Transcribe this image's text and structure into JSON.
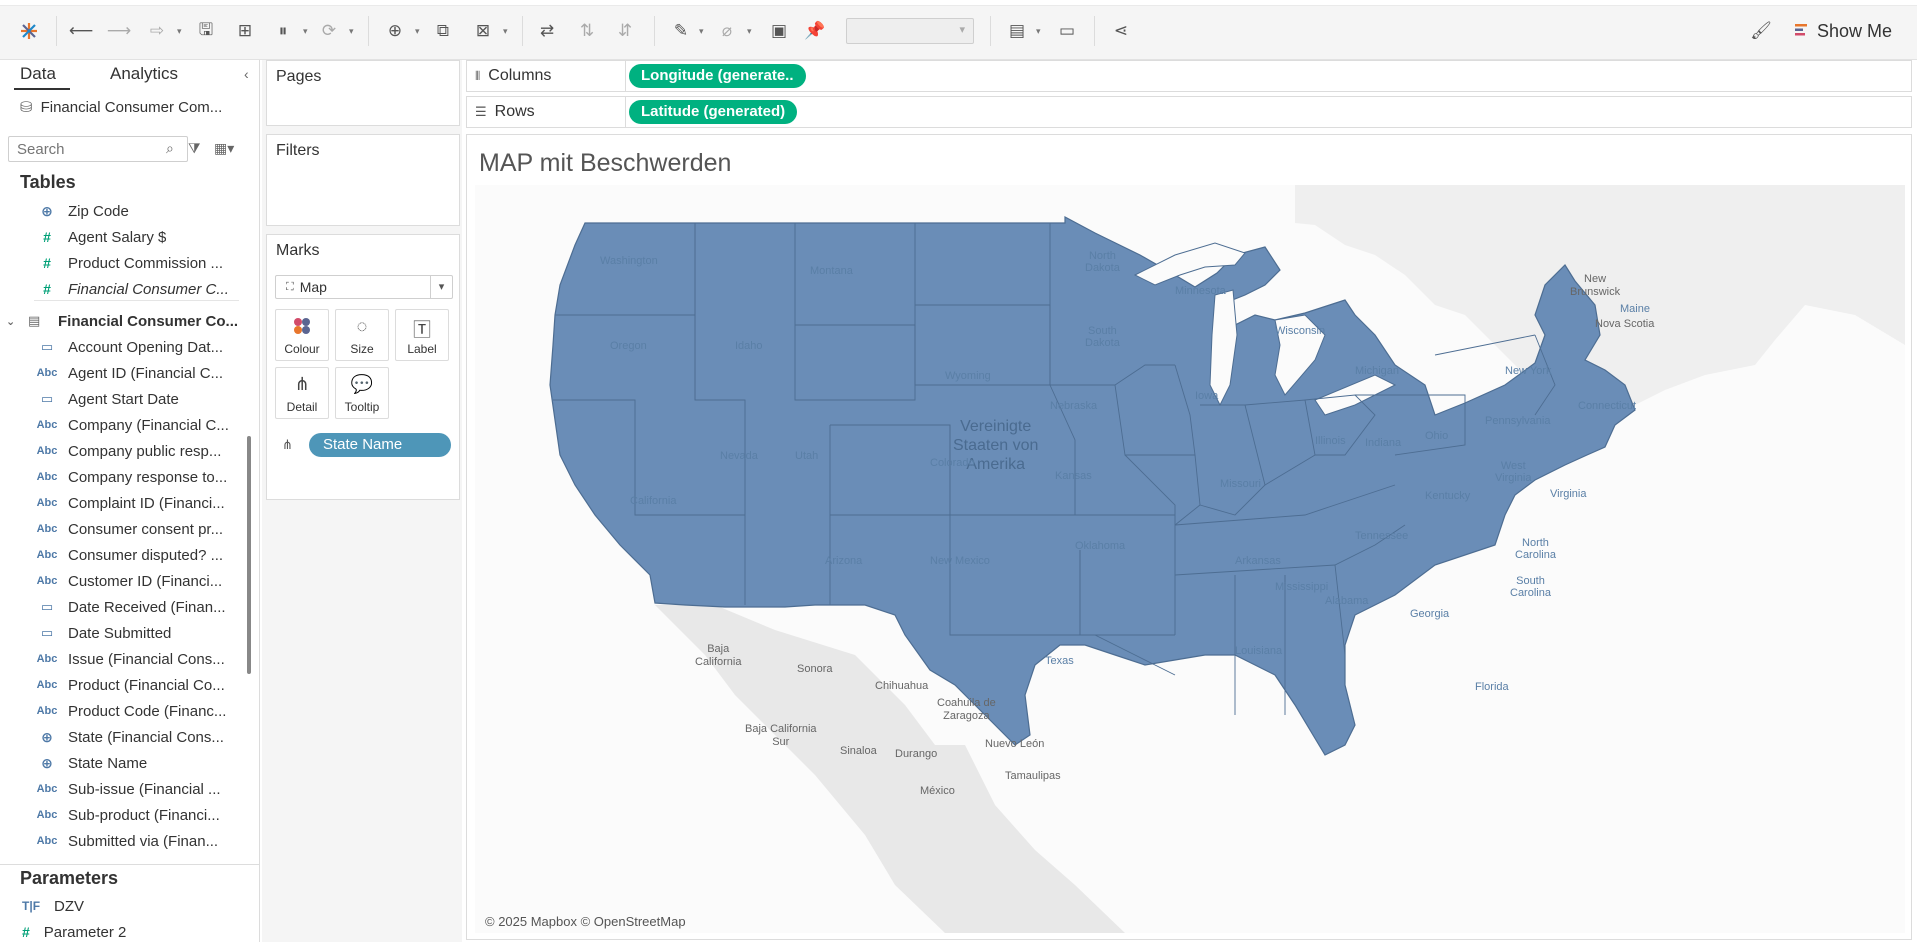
{
  "toolbar": {
    "show_me_label": "Show Me"
  },
  "left_panel": {
    "tab_data": "Data",
    "tab_analytics": "Analytics",
    "datasource": "Financial Consumer Com...",
    "search_placeholder": "Search",
    "tables_heading": "Tables",
    "top_fields": [
      {
        "type": "geo",
        "name": "Zip Code"
      },
      {
        "type": "measure",
        "name": "Agent Salary $"
      },
      {
        "type": "measure",
        "name": "Product Commission ..."
      },
      {
        "type": "measure",
        "name": "Financial Consumer C...",
        "italic": true
      }
    ],
    "table_name": "Financial Consumer Co...",
    "fields": [
      {
        "type": "date",
        "name": "Account Opening Dat..."
      },
      {
        "type": "abc",
        "name": "Agent ID (Financial C..."
      },
      {
        "type": "date",
        "name": "Agent Start Date"
      },
      {
        "type": "abc",
        "name": "Company (Financial C..."
      },
      {
        "type": "abc",
        "name": "Company public resp..."
      },
      {
        "type": "abc",
        "name": "Company response to..."
      },
      {
        "type": "abc",
        "name": "Complaint ID (Financi..."
      },
      {
        "type": "abc",
        "name": "Consumer consent pr..."
      },
      {
        "type": "abc",
        "name": "Consumer disputed? ..."
      },
      {
        "type": "abc",
        "name": "Customer ID (Financi..."
      },
      {
        "type": "date",
        "name": "Date Received (Finan..."
      },
      {
        "type": "date",
        "name": "Date Submitted"
      },
      {
        "type": "abc",
        "name": "Issue (Financial Cons..."
      },
      {
        "type": "abc",
        "name": "Product (Financial Co..."
      },
      {
        "type": "abc",
        "name": "Product Code (Financ..."
      },
      {
        "type": "geo",
        "name": "State (Financial Cons..."
      },
      {
        "type": "geo",
        "name": "State Name"
      },
      {
        "type": "abc",
        "name": "Sub-issue (Financial ..."
      },
      {
        "type": "abc",
        "name": "Sub-product (Financi..."
      },
      {
        "type": "abc",
        "name": "Submitted via (Finan..."
      }
    ],
    "params_heading": "Parameters",
    "params": [
      {
        "type": "T|F",
        "name": "DZV"
      },
      {
        "type": "#",
        "name": "Parameter 2"
      }
    ]
  },
  "shelves": {
    "pages_title": "Pages",
    "filters_title": "Filters",
    "marks_title": "Marks",
    "mark_type": "Map",
    "mark_buttons": {
      "colour": "Colour",
      "size": "Size",
      "label": "Label",
      "detail": "Detail",
      "tooltip": "Tooltip"
    },
    "detail_pill": "State Name",
    "columns_label": "Columns",
    "columns_pill": "Longitude (generate..",
    "rows_label": "Rows",
    "rows_pill": "Latitude (generated)"
  },
  "viz": {
    "title": "MAP mit Beschwerden",
    "credit": "© 2025 Mapbox © OpenStreetMap",
    "fill_color": "#6a8db7",
    "country_label": "Vereinigte\nStaaten von\nAmerika",
    "map_labels": [
      {
        "text": "New\nBrunswick"
      },
      {
        "text": "Nova Scotia"
      },
      {
        "text": "Baja\nCalifornia"
      },
      {
        "text": "Sonora"
      },
      {
        "text": "Chihuahua"
      },
      {
        "text": "Coahuila de\nZaragoza"
      },
      {
        "text": "Baja California\nSur"
      },
      {
        "text": "Sinaloa"
      },
      {
        "text": "Durango"
      },
      {
        "text": "Nuevo León"
      },
      {
        "text": "Tamaulipas"
      },
      {
        "text": "México"
      }
    ],
    "state_labels": [
      "Washington",
      "Montana",
      "North\nDakota",
      "Minnesota",
      "Oregon",
      "Idaho",
      "South\nDakota",
      "Wisconsin",
      "Michigan",
      "New York",
      "Maine",
      "Wyoming",
      "Nebraska",
      "Iowa",
      "Pennsylvania",
      "Nevada",
      "Utah",
      "Colorado",
      "Kansas",
      "Illinois",
      "Indiana",
      "Ohio",
      "West\nVirginia",
      "Virginia",
      "California",
      "Missouri",
      "Kentucky",
      "Tennessee",
      "North\nCarolina",
      "Oklahoma",
      "Arizona",
      "New Mexico",
      "Arkansas",
      "South\nCarolina",
      "Mississippi",
      "Alabama",
      "Georgia",
      "Texas",
      "Louisiana",
      "Florida",
      "Connecticut"
    ]
  }
}
